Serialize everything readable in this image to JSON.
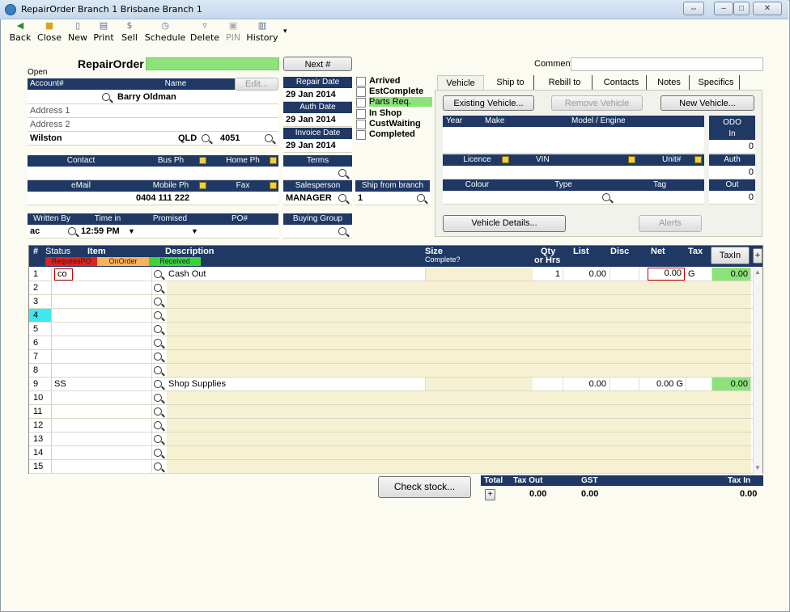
{
  "window": {
    "title": "RepairOrder  Branch 1  Brisbane Branch 1",
    "restore_glyph": "⇔",
    "min_glyph": "–",
    "max_glyph": "□",
    "close_glyph": "✕"
  },
  "toolbar": {
    "back": "Back",
    "close": "Close",
    "new": "New",
    "print": "Print",
    "sell": "Sell",
    "schedule": "Schedule",
    "delete": "Delete",
    "pin": "PIN",
    "history": "History"
  },
  "header": {
    "status": "Open",
    "title": "RepairOrder",
    "next_btn": "Next #",
    "comment_label": "Comment",
    "comment_value": ""
  },
  "customer": {
    "account_label": "Account#",
    "name_label": "Name",
    "edit_btn": "Edit...",
    "name": "Barry Oldman",
    "address1": "Address 1",
    "address2": "Address 2",
    "suburb": "Wilston",
    "state": "QLD",
    "postcode": "4051",
    "contact_label": "Contact",
    "busph_label": "Bus Ph",
    "homeph_label": "Home Ph",
    "email_label": "eMail",
    "mobile_label": "Mobile Ph",
    "fax_label": "Fax",
    "mobile": "0404 111 222",
    "written_by_label": "Written By",
    "time_in_label": "Time in",
    "promised_label": "Promised",
    "po_label": "PO#",
    "written_by": "ac",
    "time_in": "12:59 PM"
  },
  "dates": {
    "repair_label": "Repair Date",
    "repair": "29 Jan 2014",
    "auth_label": "Auth Date",
    "auth": "29 Jan 2014",
    "invoice_label": "Invoice Date",
    "invoice": "29 Jan 2014",
    "terms_label": "Terms",
    "salesperson_label": "Salesperson",
    "salesperson": "MANAGER",
    "ship_label": "Ship from branch",
    "ship": "1",
    "buying_label": "Buying Group"
  },
  "status_flags": [
    {
      "label": "Arrived",
      "highlight": false
    },
    {
      "label": "EstComplete",
      "highlight": false
    },
    {
      "label": "Parts Req.",
      "highlight": true
    },
    {
      "label": "In Shop",
      "highlight": false
    },
    {
      "label": "CustWaiting",
      "highlight": false
    },
    {
      "label": "Completed",
      "highlight": false
    }
  ],
  "tabs": [
    "Vehicle",
    "Ship to",
    "Rebill to",
    "Contacts",
    "Notes",
    "Specifics"
  ],
  "vehicle": {
    "existing_btn": "Existing Vehicle...",
    "remove_btn": "Remove Vehicle",
    "new_btn": "New Vehicle...",
    "year": "Year",
    "make": "Make",
    "model": "Model / Engine",
    "odo": "ODO",
    "odo_in": "In",
    "odo_val": "0",
    "licence": "Licence",
    "vin": "VIN",
    "unit": "Unit#",
    "auth": "Auth",
    "auth_val": "0",
    "colour": "Colour",
    "type": "Type",
    "tag": "Tag",
    "out": "Out",
    "out_val": "0",
    "details_btn": "Vehicle Details...",
    "alerts_btn": "Alerts"
  },
  "grid": {
    "headers": {
      "num": "#",
      "status": "Status",
      "item": "Item",
      "desc": "Description",
      "size": "Size",
      "complete": "Complete?",
      "qty": "Qty",
      "hrs": "or Hrs",
      "list": "List",
      "disc": "Disc",
      "net": "Net",
      "tax": "Tax",
      "taxin_btn": "TaxIn",
      "plus": "+"
    },
    "legend": [
      "RequiresPO",
      "OnOrder",
      "Received"
    ],
    "rows": [
      {
        "n": "1",
        "item": "co",
        "desc": "Cash Out",
        "qty": "1",
        "list": "0.00",
        "net": "0.00",
        "tax": "G",
        "taxin": "0.00"
      },
      {
        "n": "2"
      },
      {
        "n": "3"
      },
      {
        "n": "4"
      },
      {
        "n": "5"
      },
      {
        "n": "6"
      },
      {
        "n": "7"
      },
      {
        "n": "8"
      },
      {
        "n": "9",
        "item": "SS",
        "desc": "Shop Supplies",
        "qty": "",
        "list": "0.00",
        "net": "0.00 G",
        "tax": "",
        "taxin": "0.00"
      },
      {
        "n": "10"
      },
      {
        "n": "11"
      },
      {
        "n": "12"
      },
      {
        "n": "13"
      },
      {
        "n": "14"
      },
      {
        "n": "15"
      }
    ]
  },
  "footer": {
    "check_stock": "Check stock...",
    "total": "Total",
    "tax_out": "Tax Out",
    "gst": "GST",
    "tax_in": "Tax In",
    "plus": "+",
    "v_taxout": "0.00",
    "v_gst": "0.00",
    "v_taxin": "0.00"
  }
}
